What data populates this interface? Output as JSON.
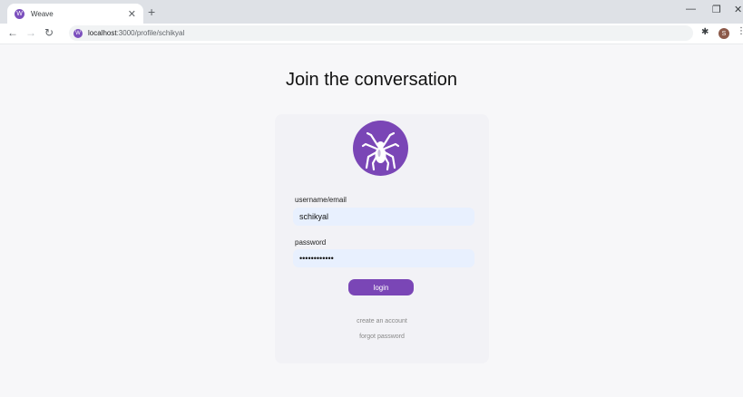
{
  "browser": {
    "tab_title": "Weave",
    "tab_favicon_letter": "W",
    "url_host": "localhost",
    "url_path": ":3000/profile/schikyal",
    "profile_initial": "S",
    "accent": "#7b4fbd"
  },
  "page": {
    "heading": "Join the conversation",
    "logo_icon": "spider-icon",
    "username_label": "username/email",
    "username_value": "schikyal",
    "password_label": "password",
    "password_value": "••••••••••••",
    "login_label": "login",
    "create_account_label": "create an account",
    "forgot_password_label": "forgot password",
    "brand_color": "#7a46b6"
  }
}
